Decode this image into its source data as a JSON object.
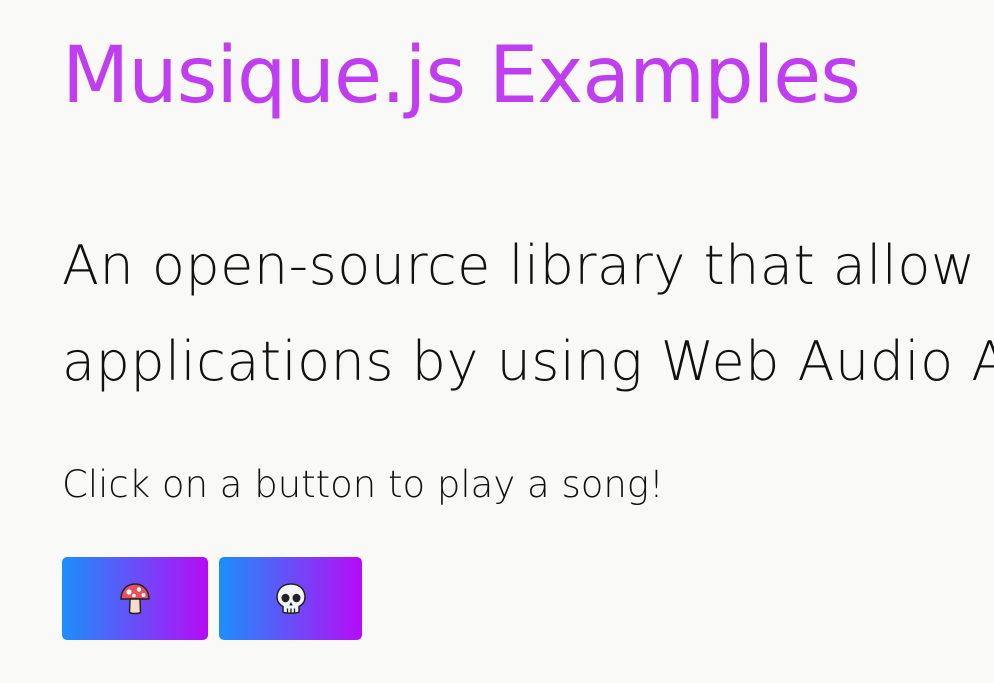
{
  "header": {
    "title": "Musique.js Examples",
    "title_color": "#c03ef0"
  },
  "intro": {
    "lines": [
      "An open-source library that allow",
      "applications by using Web Audio A"
    ]
  },
  "prompt": {
    "text": "Click on a button to play a song!"
  },
  "songs": [
    {
      "icon": "mushroom-icon"
    },
    {
      "icon": "skull-icon"
    }
  ],
  "colors": {
    "background": "#f9f9f8",
    "button_gradient_start": "#1c8ffb",
    "button_gradient_end": "#b60cf6",
    "text": "#111111"
  }
}
